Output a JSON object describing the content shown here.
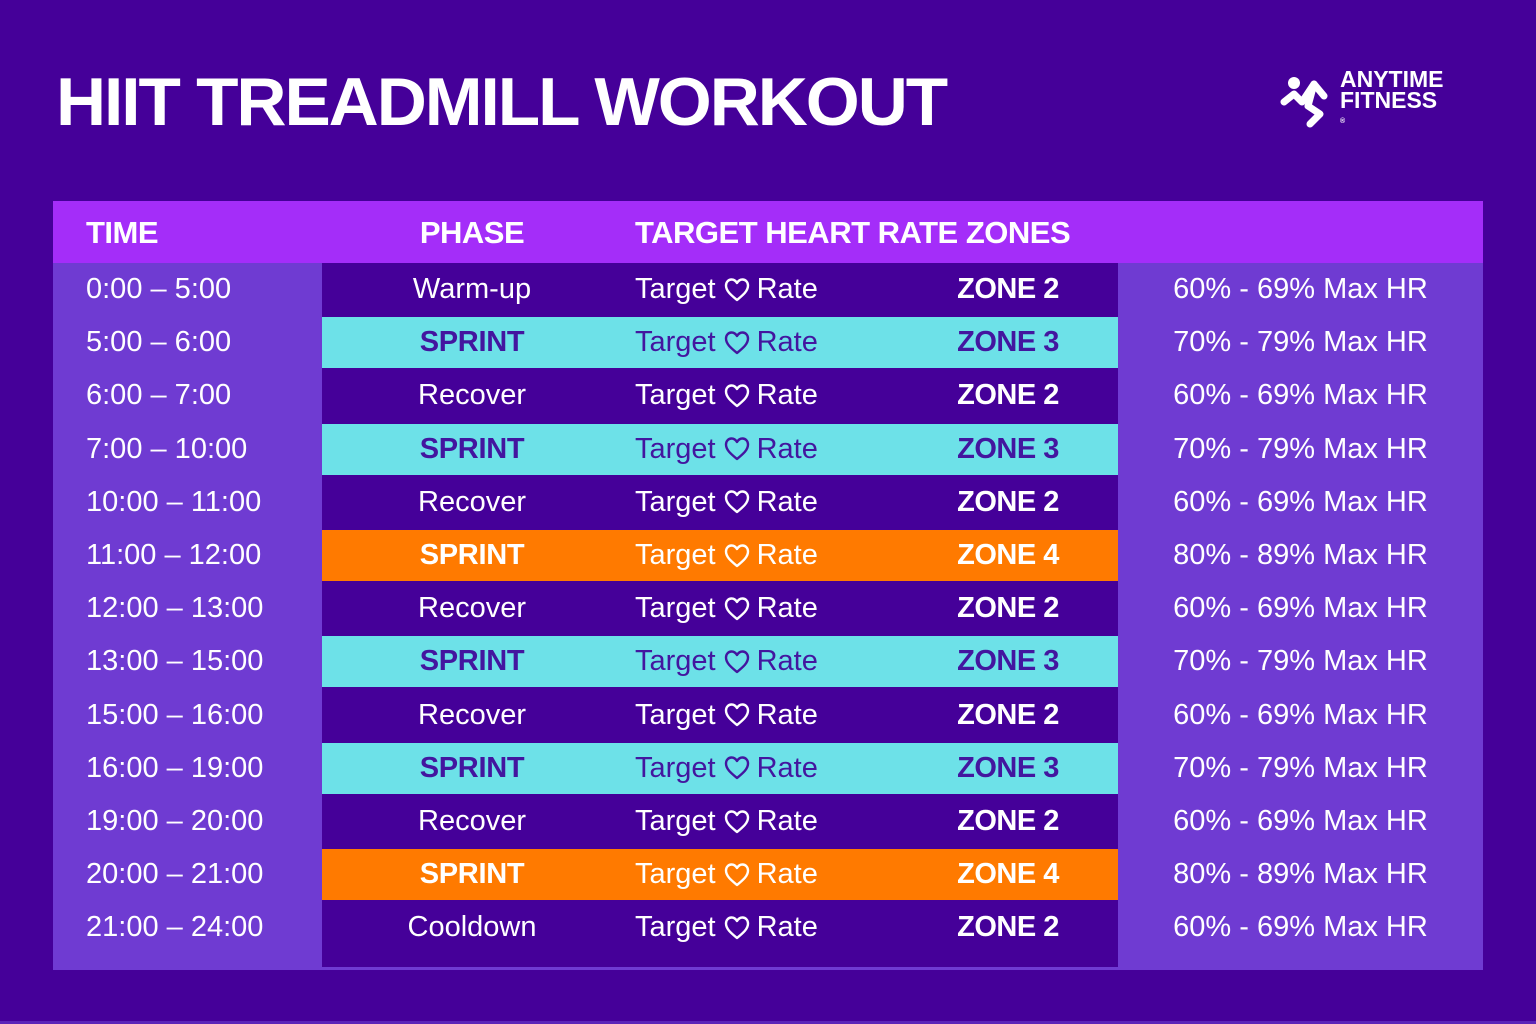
{
  "title": "HIIT TREADMILL WORKOUT",
  "logo": {
    "icon": "running-figure-icon",
    "line1": "ANYTIME",
    "line2": "FITNESS",
    "registered": "®"
  },
  "colors": {
    "background": "#450099",
    "header": "#a42df9",
    "side_columns": "#6f3bd2",
    "sprint_zone3": "#6de1e8",
    "sprint_zone4": "#ff7a00",
    "dark_text": "#43169f"
  },
  "table": {
    "headers": {
      "time": "TIME",
      "phase": "PHASE",
      "zones": "TARGET HEART RATE ZONES"
    },
    "heart_icon": "heart-outline-icon",
    "rows": [
      {
        "time": "0:00 – 5:00",
        "phase": "Warm-up",
        "target_a": "Target",
        "target_b": "Rate",
        "zone": "ZONE 2",
        "range": "60% - 69% Max HR",
        "highlight": "none"
      },
      {
        "time": "5:00 – 6:00",
        "phase": "SPRINT",
        "target_a": "Target",
        "target_b": "Rate",
        "zone": "ZONE 3",
        "range": "70% - 79% Max HR",
        "highlight": "cyan"
      },
      {
        "time": "6:00 – 7:00",
        "phase": "Recover",
        "target_a": "Target",
        "target_b": "Rate",
        "zone": "ZONE 2",
        "range": "60% - 69% Max HR",
        "highlight": "none"
      },
      {
        "time": "7:00 –  10:00",
        "phase": "SPRINT",
        "target_a": "Target",
        "target_b": "Rate",
        "zone": "ZONE 3",
        "range": "70% - 79% Max HR",
        "highlight": "cyan"
      },
      {
        "time": "10:00 – 11:00",
        "phase": "Recover",
        "target_a": "Target",
        "target_b": "Rate",
        "zone": "ZONE 2",
        "range": "60% - 69% Max HR",
        "highlight": "none"
      },
      {
        "time": "11:00 – 12:00",
        "phase": "SPRINT",
        "target_a": "Target",
        "target_b": "Rate",
        "zone": "ZONE 4",
        "range": "80% - 89% Max HR",
        "highlight": "orange"
      },
      {
        "time": "12:00 – 13:00",
        "phase": "Recover",
        "target_a": "Target",
        "target_b": "Rate",
        "zone": "ZONE 2",
        "range": "60% - 69% Max HR",
        "highlight": "none"
      },
      {
        "time": "13:00 – 15:00",
        "phase": "SPRINT",
        "target_a": "Target",
        "target_b": "Rate",
        "zone": "ZONE 3",
        "range": "70% - 79% Max HR",
        "highlight": "cyan"
      },
      {
        "time": "15:00 – 16:00",
        "phase": "Recover",
        "target_a": "Target",
        "target_b": "Rate",
        "zone": "ZONE 2",
        "range": "60% - 69% Max HR",
        "highlight": "none"
      },
      {
        "time": "16:00 – 19:00",
        "phase": "SPRINT",
        "target_a": "Target",
        "target_b": "Rate",
        "zone": "ZONE 3",
        "range": "70% - 79% Max HR",
        "highlight": "cyan"
      },
      {
        "time": "19:00 – 20:00",
        "phase": "Recover",
        "target_a": "Target",
        "target_b": "Rate",
        "zone": "ZONE 2",
        "range": "60% - 69% Max HR",
        "highlight": "none"
      },
      {
        "time": "20:00 – 21:00",
        "phase": "SPRINT",
        "target_a": "Target",
        "target_b": "Rate",
        "zone": "ZONE 4",
        "range": "80% - 89% Max HR",
        "highlight": "orange"
      },
      {
        "time": "21:00 – 24:00",
        "phase": "Cooldown",
        "target_a": "Target",
        "target_b": "Rate",
        "zone": "ZONE 2",
        "range": "60% - 69% Max HR",
        "highlight": "none"
      }
    ]
  }
}
